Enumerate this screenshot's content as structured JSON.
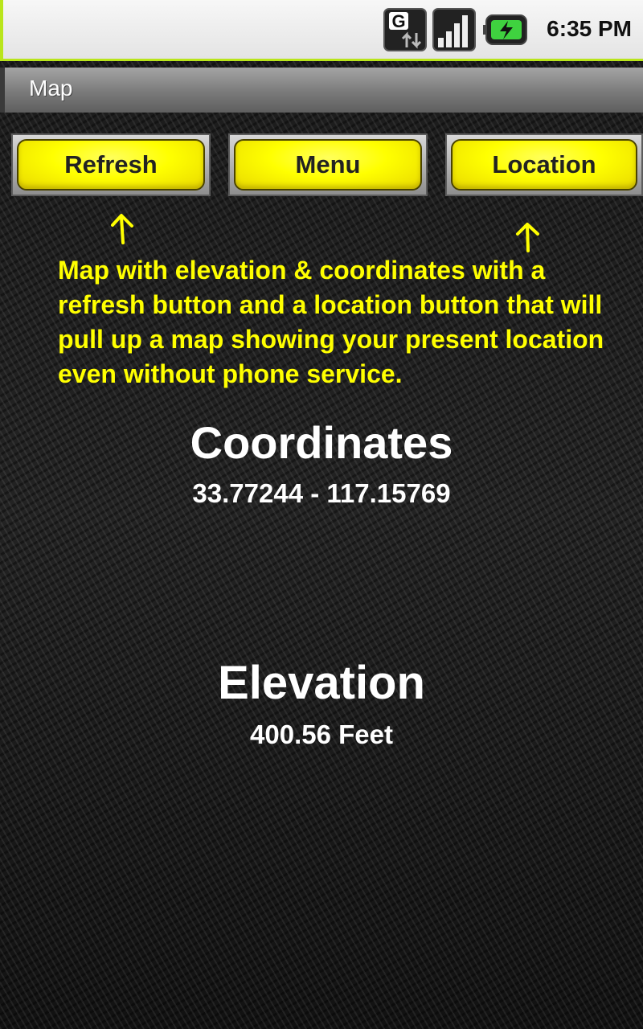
{
  "status_bar": {
    "time": "6:35 PM",
    "icons": [
      "network-g-icon",
      "signal-icon",
      "battery-icon"
    ],
    "network_label": "G"
  },
  "title_bar": {
    "title": "Map"
  },
  "buttons": {
    "refresh": "Refresh",
    "menu": "Menu",
    "location": "Location"
  },
  "annotation": {
    "text": "Map with elevation & coordinates with a refresh button and a location button that will pull up a map showing your present location even without phone service."
  },
  "coordinates": {
    "heading": "Coordinates",
    "value": "33.77244 - 117.15769"
  },
  "elevation": {
    "heading": "Elevation",
    "value": "400.56 Feet"
  },
  "colors": {
    "button": "#ffff00",
    "annotation": "#ffff00",
    "status_accent": "#b9e51b",
    "text": "#ffffff"
  }
}
